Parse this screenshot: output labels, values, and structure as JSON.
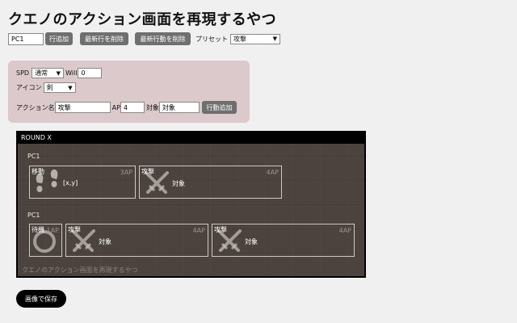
{
  "title": "クエノのアクション画面を再現するやつ",
  "toolbar": {
    "row_name_value": "PC1",
    "add_row_label": "行追加",
    "delete_last_row_label": "最新行を削除",
    "delete_last_action_label": "最新行動を削除",
    "preset_label": "プリセット",
    "preset_value": "攻撃"
  },
  "form": {
    "spd_label": "SPD",
    "spd_value": "通常",
    "will_label": "Will",
    "will_value": "0",
    "icon_label": "アイコン",
    "icon_value": "剣",
    "action_name_label": "アクション名",
    "action_name_value": "攻撃",
    "ap_label": "AP",
    "ap_value": "4",
    "target_label": "対象",
    "target_value": "対象",
    "add_action_label": "行動追加"
  },
  "round": {
    "header": "ROUND X",
    "rows": [
      {
        "label": "PC1",
        "actions": [
          {
            "name": "移動",
            "ap": "3AP",
            "target": "[x,y]",
            "icon": "footprints-icon"
          },
          {
            "name": "攻撃",
            "ap": "4AP",
            "target": "対象",
            "icon": "crossed-swords-icon"
          }
        ]
      },
      {
        "label": "PC1",
        "actions": [
          {
            "name": "待機",
            "ap": "1AP",
            "target": "",
            "icon": "ring-icon"
          },
          {
            "name": "攻撃",
            "ap": "4AP",
            "target": "対象",
            "icon": "crossed-swords-icon"
          },
          {
            "name": "攻撃",
            "ap": "4AP",
            "target": "対象",
            "icon": "crossed-swords-icon"
          }
        ]
      }
    ],
    "footer": "クエノのアクション画面を再現するやつ"
  },
  "save_button_label": "画像で保存"
}
